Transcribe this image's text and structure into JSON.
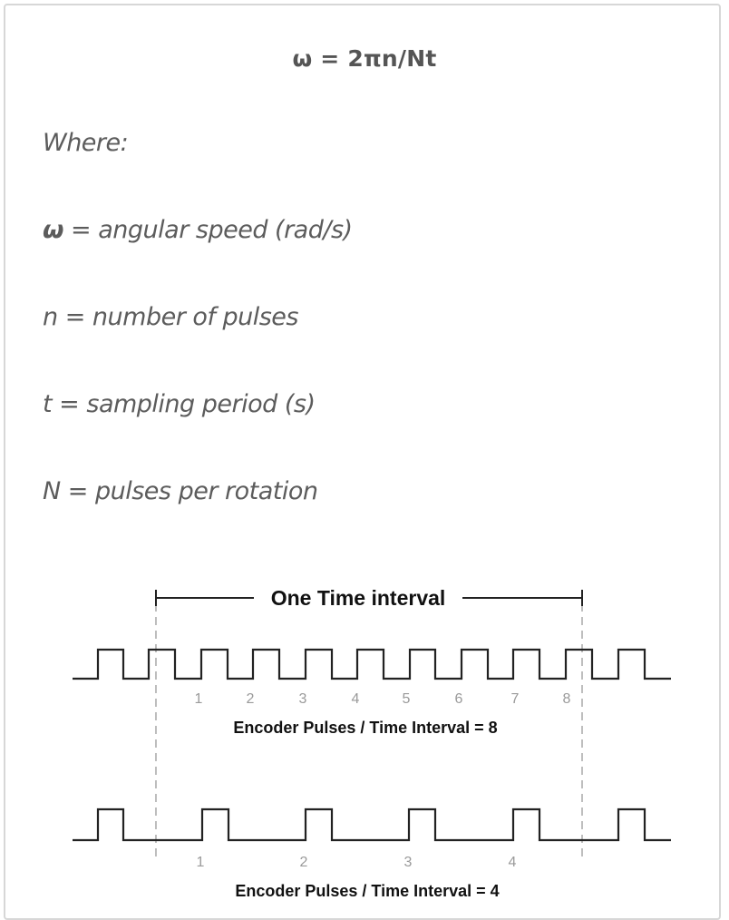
{
  "formula": "ω = 2πn/Nt",
  "where_label": "Where:",
  "definitions": [
    {
      "symbol": "ω",
      "text": " = angular speed (rad/s)"
    },
    {
      "symbol": "n",
      "text": " = number of pulses"
    },
    {
      "symbol": "t",
      "text": " = sampling period (s)"
    },
    {
      "symbol": "N",
      "text": " = pulses per rotation"
    }
  ],
  "diagram": {
    "interval_label": "One Time interval",
    "fast": {
      "numbers": [
        "1",
        "2",
        "3",
        "4",
        "5",
        "6",
        "7",
        "8"
      ],
      "caption": "Encoder Pulses / Time Interval = 8"
    },
    "slow": {
      "numbers": [
        "1",
        "2",
        "3",
        "4"
      ],
      "caption": "Encoder Pulses / Time Interval = 4"
    }
  },
  "colors": {
    "text": "#5c5c5c",
    "signal": "#222222",
    "dash": "#9a9a9a"
  }
}
